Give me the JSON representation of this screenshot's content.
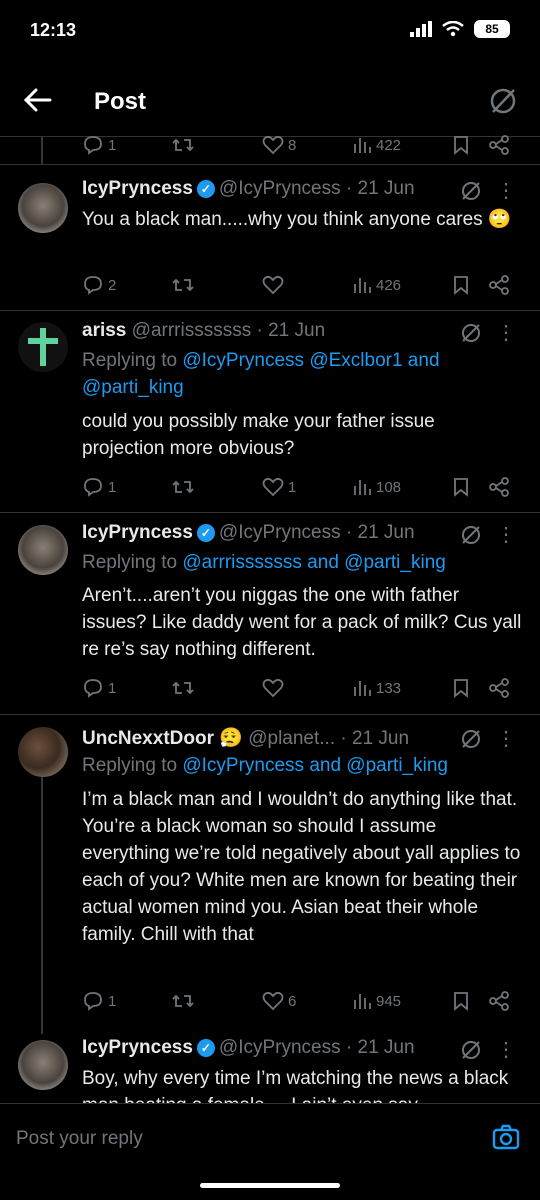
{
  "status_bar": {
    "time": "12:13",
    "battery": "85"
  },
  "header": {
    "title": "Post"
  },
  "prev_actions": {
    "replies": "1",
    "reposts": "",
    "likes": "8",
    "views": "422"
  },
  "tweets": [
    {
      "name": "IcyPryncess",
      "handle": "@IcyPryncess",
      "date": "· 21 Jun",
      "verified": true,
      "replying_prefix": "",
      "replying_to": "",
      "text": "You a black man.....why you think anyone cares 🙄",
      "replies": "2",
      "reposts": "",
      "likes": "",
      "views": "426"
    },
    {
      "name": "ariss",
      "handle": "@arrrisssssss",
      "date": "· 21 Jun",
      "verified": false,
      "replying_prefix": "Replying to ",
      "replying_to": "@IcyPryncess @Exclbor1 and",
      "replying_to_2": "@parti_king",
      "text": "could you possibly make your father issue projection more obvious?",
      "replies": "1",
      "reposts": "",
      "likes": "1",
      "views": "108"
    },
    {
      "name": "IcyPryncess",
      "handle": "@IcyPryncess",
      "date": "· 21 Jun",
      "verified": true,
      "replying_prefix": "Replying to ",
      "replying_to": "@arrrisssssss and @parti_king",
      "text": "Aren’t....aren’t you niggas the one with father issues? Like daddy went for a pack of milk? Cus yall re re’s say nothing different.",
      "replies": "1",
      "reposts": "",
      "likes": "",
      "views": "133"
    },
    {
      "name": "UncNexxtDoor",
      "handle": "@planet...",
      "date": "· 21 Jun",
      "verified": false,
      "emoji": "😮‍💨",
      "replying_prefix": "Replying to ",
      "replying_to": "@IcyPryncess and @parti_king",
      "text": "I’m a black man and I wouldn’t do anything like that. You’re a black woman so should I assume everything we’re told negatively about yall applies to each of you? White men are known for beating their actual women mind you. Asian beat their whole family. Chill with that",
      "replies": "1",
      "reposts": "",
      "likes": "6",
      "views": "945"
    },
    {
      "name": "IcyPryncess",
      "handle": "@IcyPryncess",
      "date": "· 21 Jun",
      "verified": true,
      "text": "Boy, why every time I’m watching the news a black man beating a female.... I ain’t even say"
    }
  ],
  "reply_bar": {
    "placeholder": "Post your reply"
  },
  "colors": {
    "background": "#000000",
    "text": "#e7e9ea",
    "muted": "#71767b",
    "accent": "#1d9bf0",
    "divider": "#2f3336"
  }
}
